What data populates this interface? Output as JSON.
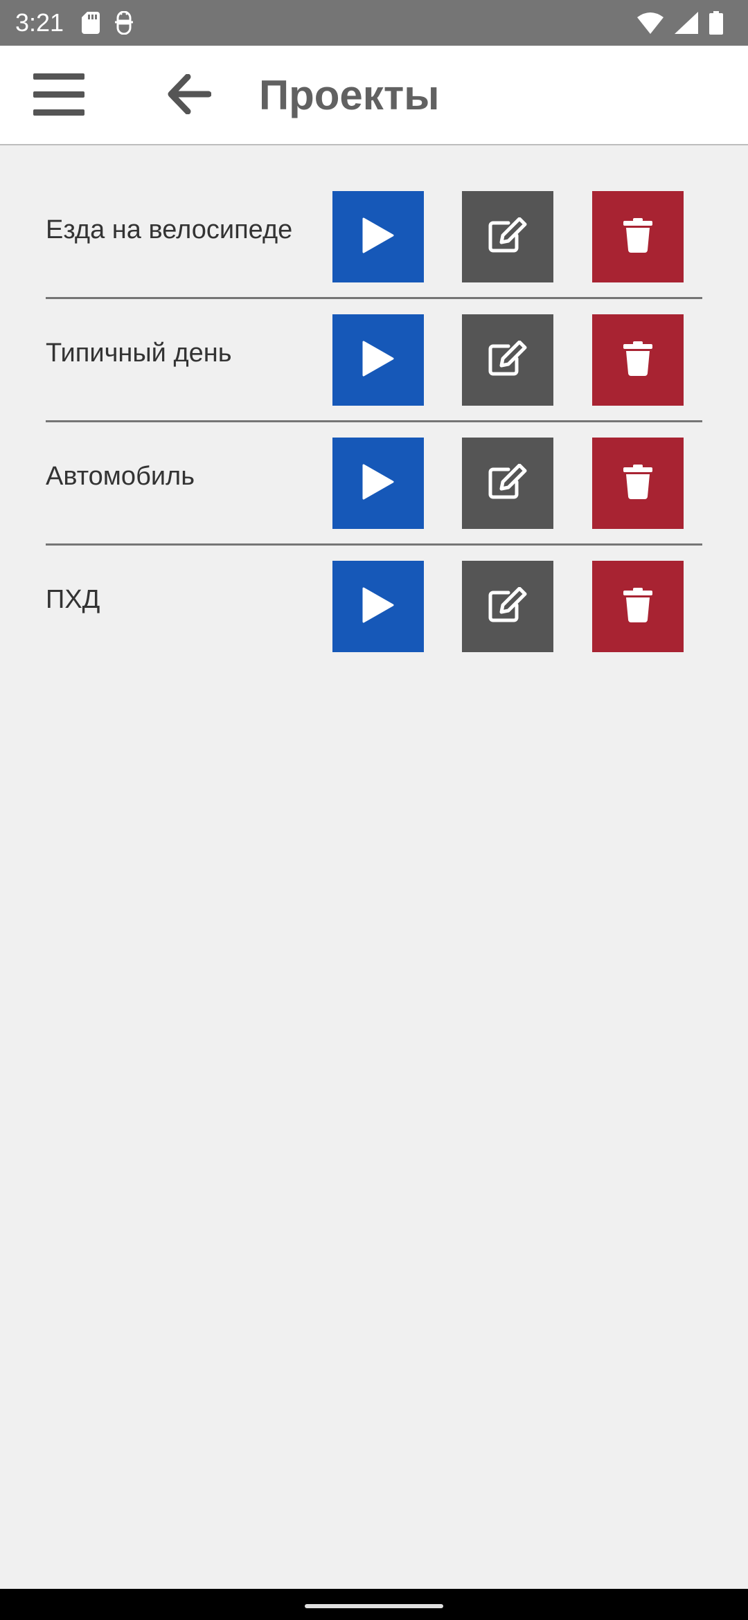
{
  "status_bar": {
    "time": "3:21",
    "left_icons": [
      "sd-card-icon",
      "android-debug-icon"
    ],
    "right_icons": [
      "wifi-icon",
      "cell-signal-icon",
      "battery-icon"
    ]
  },
  "app_bar": {
    "title": "Проекты",
    "menu_icon": "hamburger-menu-icon",
    "back_icon": "arrow-left-icon"
  },
  "projects": [
    {
      "name": "Езда на велосипеде"
    },
    {
      "name": "Типичный день"
    },
    {
      "name": "Автомобиль"
    },
    {
      "name": "ПХД"
    }
  ],
  "actions": {
    "play_icon": "play-icon",
    "edit_icon": "edit-icon",
    "delete_icon": "trash-icon"
  },
  "colors": {
    "status_bar": "#757575",
    "app_bar": "#ffffff",
    "background": "#f0f0f0",
    "play": "#1658b8",
    "edit": "#555555",
    "delete": "#a82332",
    "title": "#616161",
    "text": "#333333",
    "divider": "#757575"
  }
}
